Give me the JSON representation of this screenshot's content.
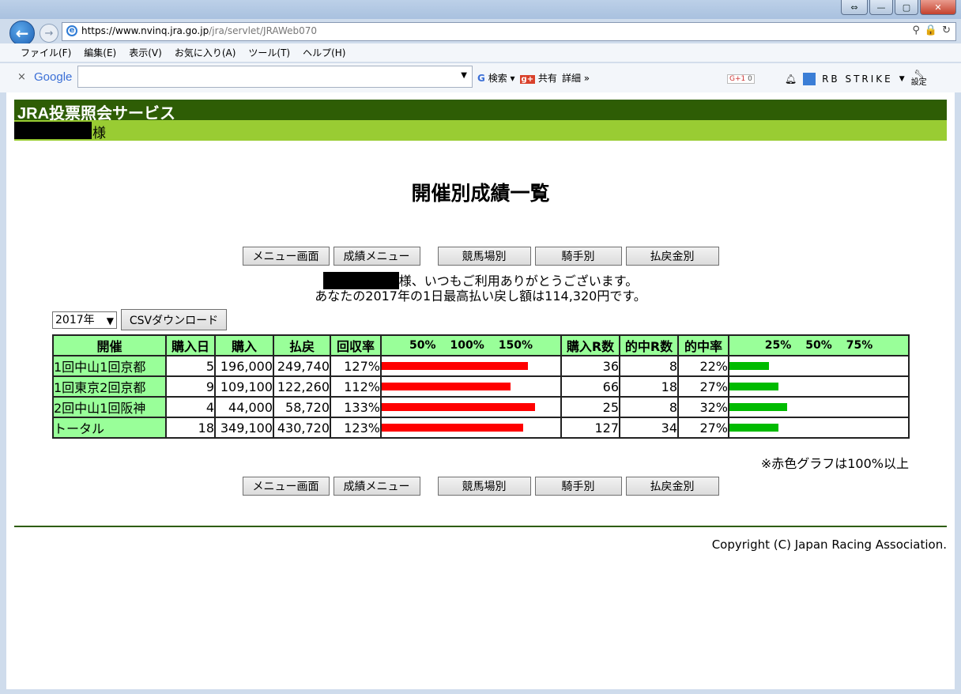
{
  "browser": {
    "url_prefix": "https://www.nvinq.",
    "url_domain": "jra.go.jp",
    "url_path": "/jra/servlet/JRAWeb070",
    "menu": [
      "ファイル(F)",
      "編集(E)",
      "表示(V)",
      "お気に入り(A)",
      "ツール(T)",
      "ヘルプ(H)"
    ],
    "google": {
      "close": "×",
      "logo": "Google",
      "search_label": "検索",
      "share_label": "共有",
      "details_label": "詳細 »",
      "g1_label": "G+1",
      "g1_count": "0",
      "user_name": "RB STRIKE",
      "settings_label": "設定"
    }
  },
  "site": {
    "title": "JRA投票照会サービス",
    "user_suffix": "様"
  },
  "page": {
    "title": "開催別成績一覧",
    "nav_buttons": [
      "メニュー画面",
      "成績メニュー",
      "競馬場別",
      "騎手別",
      "払戻金別"
    ],
    "greeting_line1": "様、いつもご利用ありがとうございます。",
    "greeting_line2": "あなたの2017年の1日最高払い戻し額は114,320円です。",
    "year_select": "2017年",
    "csv_button": "CSVダウンロード",
    "note": "※赤色グラフは100%以上",
    "copyright": "Copyright (C) Japan Racing Association."
  },
  "table": {
    "headers": [
      "開催",
      "購入日",
      "購入",
      "払戻",
      "回収率",
      "",
      "購入R数",
      "的中R数",
      "的中率",
      ""
    ],
    "recovery_scale": [
      "50%",
      "100%",
      "150%"
    ],
    "hit_scale": [
      "25%",
      "50%",
      "75%"
    ],
    "rows": [
      {
        "name": "1回中山1回京都",
        "days": "5",
        "buy": "196,000",
        "payout": "249,740",
        "rate": "127%",
        "rate_val": 127,
        "races": "36",
        "hits": "8",
        "hit_rate": "22%",
        "hit_val": 22
      },
      {
        "name": "1回東京2回京都",
        "days": "9",
        "buy": "109,100",
        "payout": "122,260",
        "rate": "112%",
        "rate_val": 112,
        "races": "66",
        "hits": "18",
        "hit_rate": "27%",
        "hit_val": 27
      },
      {
        "name": "2回中山1回阪神",
        "days": "4",
        "buy": "44,000",
        "payout": "58,720",
        "rate": "133%",
        "rate_val": 133,
        "races": "25",
        "hits": "8",
        "hit_rate": "32%",
        "hit_val": 32
      },
      {
        "name": "トータル",
        "days": "18",
        "buy": "349,100",
        "payout": "430,720",
        "rate": "123%",
        "rate_val": 123,
        "races": "127",
        "hits": "34",
        "hit_rate": "27%",
        "hit_val": 27
      }
    ]
  },
  "colors": {
    "header_green": "#2e5d05",
    "user_bar": "#99cc33",
    "table_header": "#99ff99",
    "bar_red": "#ff0000",
    "bar_green": "#00bb00"
  }
}
